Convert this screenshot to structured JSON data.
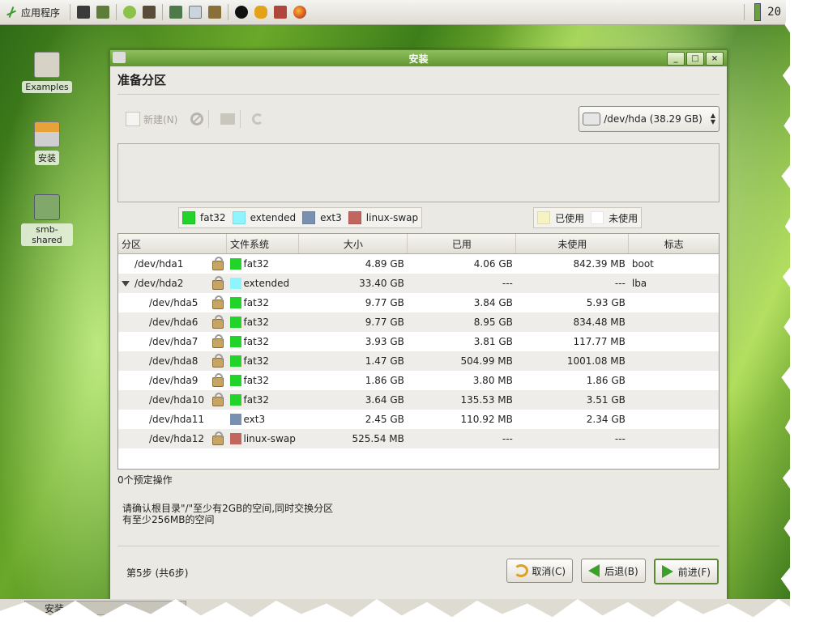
{
  "panel": {
    "app_menu_label": "应用程序",
    "clock": "20"
  },
  "desktop_icons": [
    {
      "label": "Examples"
    },
    {
      "label": "安装"
    },
    {
      "label": "smb-shared"
    }
  ],
  "window": {
    "title": "安装",
    "heading": "准备分区",
    "toolbar": {
      "new_label": "新建(N)",
      "device": "/dev/hda  (38.29 GB)"
    },
    "legend": [
      {
        "label": "fat32",
        "color": "#22d32a"
      },
      {
        "label": "extended",
        "color": "#8ef5ff"
      },
      {
        "label": "ext3",
        "color": "#7990b0"
      },
      {
        "label": "linux-swap",
        "color": "#c2655e"
      }
    ],
    "usage_legend": [
      {
        "label": "已使用",
        "color": "#f5f3c2"
      },
      {
        "label": "未使用",
        "color": "#ffffff"
      }
    ],
    "table": {
      "headers": [
        "分区",
        "文件系统",
        "大小",
        "已用",
        "未使用",
        "标志"
      ],
      "rows": [
        {
          "partition": "/dev/hda1",
          "fs": "fat32",
          "size": "4.89 GB",
          "used": "4.06 GB",
          "unused": "842.39 MB",
          "flags": "boot"
        },
        {
          "partition": "/dev/hda2",
          "fs": "extended",
          "size": "33.40 GB",
          "used": "---",
          "unused": "---",
          "flags": "lba"
        },
        {
          "partition": "/dev/hda5",
          "fs": "fat32",
          "size": "9.77 GB",
          "used": "3.84 GB",
          "unused": "5.93 GB",
          "flags": ""
        },
        {
          "partition": "/dev/hda6",
          "fs": "fat32",
          "size": "9.77 GB",
          "used": "8.95 GB",
          "unused": "834.48 MB",
          "flags": ""
        },
        {
          "partition": "/dev/hda7",
          "fs": "fat32",
          "size": "3.93 GB",
          "used": "3.81 GB",
          "unused": "117.77 MB",
          "flags": ""
        },
        {
          "partition": "/dev/hda8",
          "fs": "fat32",
          "size": "1.47 GB",
          "used": "504.99 MB",
          "unused": "1001.08 MB",
          "flags": ""
        },
        {
          "partition": "/dev/hda9",
          "fs": "fat32",
          "size": "1.86 GB",
          "used": "3.80 MB",
          "unused": "1.86 GB",
          "flags": ""
        },
        {
          "partition": "/dev/hda10",
          "fs": "fat32",
          "size": "3.64 GB",
          "used": "135.53 MB",
          "unused": "3.51 GB",
          "flags": ""
        },
        {
          "partition": "/dev/hda11",
          "fs": "ext3",
          "size": "2.45 GB",
          "used": "110.92 MB",
          "unused": "2.34 GB",
          "flags": ""
        },
        {
          "partition": "/dev/hda12",
          "fs": "linux-swap",
          "size": "525.54 MB",
          "used": "---",
          "unused": "---",
          "flags": ""
        }
      ]
    },
    "pending_ops": "0个预定操作",
    "hint_line1": "请确认根目录\"/\"至少有2GB的空间,同时交换分区",
    "hint_line2": "有至少256MB的空间",
    "step": "第5步 (共6步)",
    "buttons": {
      "cancel": "取消(C)",
      "back": "后退(B)",
      "forward": "前进(F)"
    }
  },
  "taskbar": {
    "item_label": "安装"
  }
}
